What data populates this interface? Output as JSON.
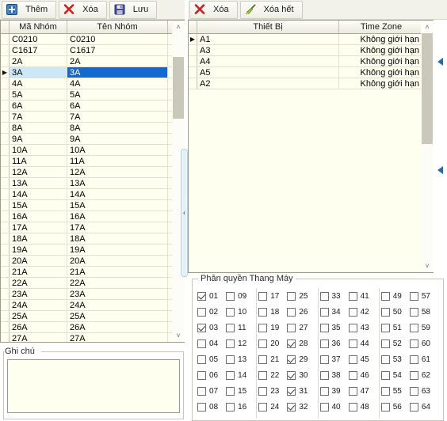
{
  "toolbar_left": {
    "buttons": [
      {
        "label": "Thêm",
        "icon": "add-plus-icon"
      },
      {
        "label": "Xóa",
        "icon": "delete-x-icon"
      },
      {
        "label": "Lưu",
        "icon": "save-floppy-icon"
      }
    ]
  },
  "toolbar_right": {
    "buttons": [
      {
        "label": "Xóa",
        "icon": "delete-x-icon"
      },
      {
        "label": "Xóa hết",
        "icon": "broom-icon"
      }
    ]
  },
  "groups_grid": {
    "columns": [
      "Mã Nhóm",
      "Tên Nhóm"
    ],
    "selected_row_index": 3,
    "rows": [
      {
        "code": "C0210",
        "name": "C0210"
      },
      {
        "code": "C1617",
        "name": "C1617"
      },
      {
        "code": "2A",
        "name": "2A"
      },
      {
        "code": "3A",
        "name": "3A"
      },
      {
        "code": "4A",
        "name": "4A"
      },
      {
        "code": "5A",
        "name": "5A"
      },
      {
        "code": "6A",
        "name": "6A"
      },
      {
        "code": "7A",
        "name": "7A"
      },
      {
        "code": "8A",
        "name": "8A"
      },
      {
        "code": "9A",
        "name": "9A"
      },
      {
        "code": "10A",
        "name": "10A"
      },
      {
        "code": "11A",
        "name": "11A"
      },
      {
        "code": "12A",
        "name": "12A"
      },
      {
        "code": "13A",
        "name": "13A"
      },
      {
        "code": "14A",
        "name": "14A"
      },
      {
        "code": "15A",
        "name": "15A"
      },
      {
        "code": "16A",
        "name": "16A"
      },
      {
        "code": "17A",
        "name": "17A"
      },
      {
        "code": "18A",
        "name": "18A"
      },
      {
        "code": "19A",
        "name": "19A"
      },
      {
        "code": "20A",
        "name": "20A"
      },
      {
        "code": "21A",
        "name": "21A"
      },
      {
        "code": "22A",
        "name": "22A"
      },
      {
        "code": "23A",
        "name": "23A"
      },
      {
        "code": "24A",
        "name": "24A"
      },
      {
        "code": "25A",
        "name": "25A"
      },
      {
        "code": "26A",
        "name": "26A"
      },
      {
        "code": "27A",
        "name": "27A"
      }
    ]
  },
  "devices_grid": {
    "columns": [
      "Thiết Bị",
      "Time Zone"
    ],
    "current_row_index": 0,
    "rows": [
      {
        "device": "A1",
        "timezone": "Không giới hạn"
      },
      {
        "device": "A3",
        "timezone": "Không giới hạn"
      },
      {
        "device": "A4",
        "timezone": "Không giới hạn"
      },
      {
        "device": "A5",
        "timezone": "Không giới hạn"
      },
      {
        "device": "A2",
        "timezone": "Không giới hạn"
      }
    ]
  },
  "note": {
    "title": "Ghi chú",
    "value": ""
  },
  "permissions": {
    "title": "Phân quyền Thang Máy",
    "columns": [
      {
        "sub": [
          {
            "label": "01",
            "checked": true
          },
          {
            "label": "02",
            "checked": false
          },
          {
            "label": "03",
            "checked": true
          },
          {
            "label": "04",
            "checked": false
          },
          {
            "label": "05",
            "checked": false
          },
          {
            "label": "06",
            "checked": false
          },
          {
            "label": "07",
            "checked": false
          },
          {
            "label": "08",
            "checked": false
          }
        ]
      },
      {
        "sub": [
          {
            "label": "09",
            "checked": false
          },
          {
            "label": "10",
            "checked": false
          },
          {
            "label": "11",
            "checked": false
          },
          {
            "label": "12",
            "checked": false
          },
          {
            "label": "13",
            "checked": false
          },
          {
            "label": "14",
            "checked": false
          },
          {
            "label": "15",
            "checked": false
          },
          {
            "label": "16",
            "checked": false
          }
        ]
      },
      {
        "sub": [
          {
            "label": "17",
            "checked": false
          },
          {
            "label": "18",
            "checked": false
          },
          {
            "label": "19",
            "checked": false
          },
          {
            "label": "20",
            "checked": false
          },
          {
            "label": "21",
            "checked": false
          },
          {
            "label": "22",
            "checked": false
          },
          {
            "label": "23",
            "checked": false
          },
          {
            "label": "24",
            "checked": false
          }
        ]
      },
      {
        "sub": [
          {
            "label": "25",
            "checked": false
          },
          {
            "label": "26",
            "checked": false
          },
          {
            "label": "27",
            "checked": false
          },
          {
            "label": "28",
            "checked": true
          },
          {
            "label": "29",
            "checked": true
          },
          {
            "label": "30",
            "checked": true
          },
          {
            "label": "31",
            "checked": true
          },
          {
            "label": "32",
            "checked": true
          }
        ]
      },
      {
        "sub": [
          {
            "label": "33",
            "checked": false
          },
          {
            "label": "34",
            "checked": false
          },
          {
            "label": "35",
            "checked": false
          },
          {
            "label": "36",
            "checked": false
          },
          {
            "label": "37",
            "checked": false
          },
          {
            "label": "38",
            "checked": false
          },
          {
            "label": "39",
            "checked": false
          },
          {
            "label": "40",
            "checked": false
          }
        ]
      },
      {
        "sub": [
          {
            "label": "41",
            "checked": false
          },
          {
            "label": "42",
            "checked": false
          },
          {
            "label": "43",
            "checked": false
          },
          {
            "label": "44",
            "checked": false
          },
          {
            "label": "45",
            "checked": false
          },
          {
            "label": "46",
            "checked": false
          },
          {
            "label": "47",
            "checked": false
          },
          {
            "label": "48",
            "checked": false
          }
        ]
      },
      {
        "sub": [
          {
            "label": "49",
            "checked": false
          },
          {
            "label": "50",
            "checked": false
          },
          {
            "label": "51",
            "checked": false
          },
          {
            "label": "52",
            "checked": false
          },
          {
            "label": "53",
            "checked": false
          },
          {
            "label": "54",
            "checked": false
          },
          {
            "label": "55",
            "checked": false
          },
          {
            "label": "56",
            "checked": false
          }
        ]
      },
      {
        "sub": [
          {
            "label": "57",
            "checked": false
          },
          {
            "label": "58",
            "checked": false
          },
          {
            "label": "59",
            "checked": false
          },
          {
            "label": "60",
            "checked": false
          },
          {
            "label": "61",
            "checked": false
          },
          {
            "label": "62",
            "checked": false
          },
          {
            "label": "63",
            "checked": false
          },
          {
            "label": "64",
            "checked": false
          }
        ]
      }
    ]
  },
  "scrollbars": {
    "up_glyph": "˄",
    "down_glyph": "˅"
  },
  "splitter": {
    "collapse_glyph": "‹"
  },
  "colors": {
    "grid_background": "#fffff0",
    "selection_blue": "#1269ce",
    "selection_light": "#cce8f8",
    "toolbar_background": "#f2f1ea",
    "edge_arrow": "#2c6b9e"
  }
}
